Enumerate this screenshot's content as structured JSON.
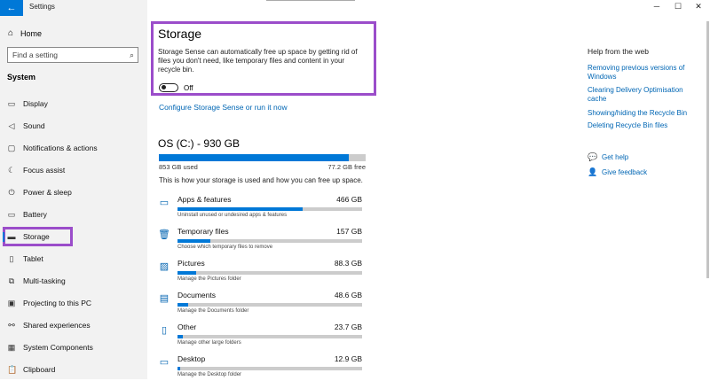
{
  "window": {
    "title": "Settings",
    "back_icon": "←",
    "min_icon": "─",
    "max_icon": "☐",
    "close_icon": "✕"
  },
  "sidebar": {
    "home_label": "Home",
    "search_placeholder": "Find a setting",
    "section_label": "System",
    "items": [
      {
        "label": "Display",
        "icon": "display-icon"
      },
      {
        "label": "Sound",
        "icon": "sound-icon"
      },
      {
        "label": "Notifications & actions",
        "icon": "notifications-icon"
      },
      {
        "label": "Focus assist",
        "icon": "moon-icon"
      },
      {
        "label": "Power & sleep",
        "icon": "power-icon"
      },
      {
        "label": "Battery",
        "icon": "battery-icon"
      },
      {
        "label": "Storage",
        "icon": "storage-icon"
      },
      {
        "label": "Tablet",
        "icon": "tablet-icon"
      },
      {
        "label": "Multi-tasking",
        "icon": "multitask-icon"
      },
      {
        "label": "Projecting to this PC",
        "icon": "project-icon"
      },
      {
        "label": "Shared experiences",
        "icon": "share-icon"
      },
      {
        "label": "System Components",
        "icon": "components-icon"
      },
      {
        "label": "Clipboard",
        "icon": "clipboard-icon"
      }
    ],
    "selected_index": 6
  },
  "main": {
    "title": "Storage",
    "description": "Storage Sense can automatically free up space by getting rid of files you don't need, like temporary files and content in your recycle bin.",
    "toggle_label": "Off",
    "config_link": "Configure Storage Sense or run it now",
    "drive": {
      "title": "OS (C:) - 930 GB",
      "used_label": "853 GB used",
      "free_label": "77.2 GB free",
      "used_fraction": 0.917,
      "info": "This is how your storage is used and how you can free up space."
    },
    "categories": [
      {
        "name": "Apps & features",
        "size": "466 GB",
        "sub": "Uninstall unused or undesired apps & features",
        "fraction": 0.68,
        "icon": "monitor-icon"
      },
      {
        "name": "Temporary files",
        "size": "157 GB",
        "sub": "Choose which temporary files to remove",
        "fraction": 0.18,
        "icon": "trash-icon"
      },
      {
        "name": "Pictures",
        "size": "88.3 GB",
        "sub": "Manage the Pictures folder",
        "fraction": 0.1,
        "icon": "picture-icon"
      },
      {
        "name": "Documents",
        "size": "48.6 GB",
        "sub": "Manage the Documents folder",
        "fraction": 0.06,
        "icon": "folder-icon"
      },
      {
        "name": "Other",
        "size": "23.7 GB",
        "sub": "Manage other large folders",
        "fraction": 0.03,
        "icon": "phone-icon"
      },
      {
        "name": "Desktop",
        "size": "12.9 GB",
        "sub": "Manage the Desktop folder",
        "fraction": 0.015,
        "icon": "desktop-icon"
      }
    ]
  },
  "help": {
    "title": "Help from the web",
    "links": [
      "Removing previous versions of Windows",
      "Clearing Delivery Optimisation cache",
      "Showing/hiding the Recycle Bin",
      "Deleting Recycle Bin files"
    ],
    "get_help": "Get help",
    "give_feedback": "Give feedback"
  },
  "colors": {
    "accent": "#0078d7",
    "highlight": "#9b4dca",
    "link": "#0066b4"
  }
}
